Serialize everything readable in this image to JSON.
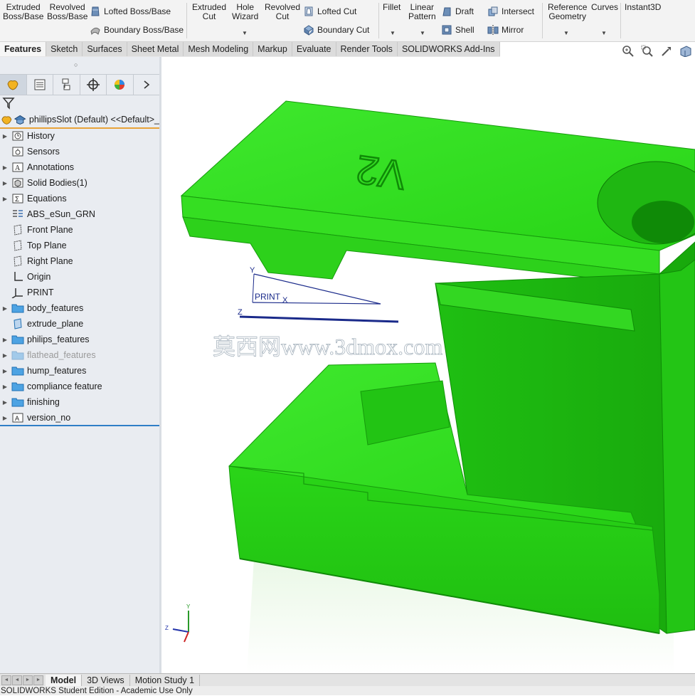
{
  "ribbon": {
    "extruded_boss": [
      "Extruded",
      "Boss/Base"
    ],
    "revolved_boss": [
      "Revolved",
      "Boss/Base"
    ],
    "lofted_boss": "Lofted Boss/Base",
    "boundary_boss": "Boundary Boss/Base",
    "extruded_cut": [
      "Extruded",
      "Cut"
    ],
    "hole_wizard": [
      "Hole",
      "Wizard"
    ],
    "revolved_cut": [
      "Revolved",
      "Cut"
    ],
    "lofted_cut": "Lofted Cut",
    "boundary_cut": "Boundary Cut",
    "fillet": "Fillet",
    "linear_pattern": [
      "Linear",
      "Pattern"
    ],
    "draft": "Draft",
    "shell": "Shell",
    "intersect": "Intersect",
    "mirror": "Mirror",
    "reference_geometry": [
      "Reference",
      "Geometry"
    ],
    "curves": "Curves",
    "instant3d": "Instant3D"
  },
  "command_tabs": [
    "Features",
    "Sketch",
    "Surfaces",
    "Sheet Metal",
    "Mesh Modeling",
    "Markup",
    "Evaluate",
    "Render Tools",
    "SOLIDWORKS Add-Ins"
  ],
  "active_tab": "Features",
  "tree": {
    "root": "phillipsSlot (Default) <<Default>_",
    "items": [
      {
        "label": "History",
        "icon": "history-icon",
        "expandable": true
      },
      {
        "label": "Sensors",
        "icon": "sensors-icon",
        "expandable": false
      },
      {
        "label": "Annotations",
        "icon": "annotations-icon",
        "expandable": true
      },
      {
        "label": "Solid Bodies(1)",
        "icon": "solid-bodies-icon",
        "expandable": true
      },
      {
        "label": "Equations",
        "icon": "equations-icon",
        "expandable": true
      },
      {
        "label": "ABS_eSun_GRN",
        "icon": "material-icon",
        "expandable": false
      },
      {
        "label": "Front Plane",
        "icon": "plane-icon",
        "expandable": false
      },
      {
        "label": "Top Plane",
        "icon": "plane-icon",
        "expandable": false
      },
      {
        "label": "Right Plane",
        "icon": "plane-icon",
        "expandable": false
      },
      {
        "label": "Origin",
        "icon": "origin-icon",
        "expandable": false
      },
      {
        "label": "PRINT",
        "icon": "coordinate-system-icon",
        "expandable": false
      },
      {
        "label": "body_features",
        "icon": "folder-icon",
        "expandable": true
      },
      {
        "label": "extrude_plane",
        "icon": "plane-feature-icon",
        "expandable": false
      },
      {
        "label": "philips_features",
        "icon": "folder-icon",
        "expandable": true
      },
      {
        "label": "flathead_features",
        "icon": "folder-icon",
        "expandable": true,
        "suppressed": true
      },
      {
        "label": "hump_features",
        "icon": "folder-icon",
        "expandable": true
      },
      {
        "label": "compliance feature",
        "icon": "folder-icon",
        "expandable": true
      },
      {
        "label": "finishing",
        "icon": "folder-icon",
        "expandable": true
      },
      {
        "label": "version_no",
        "icon": "version-text-icon",
        "expandable": true
      }
    ]
  },
  "viewport": {
    "part_text": "V2",
    "coord_label": "PRINT",
    "axis_labels": {
      "x": "X",
      "y": "Y",
      "z": "Z"
    },
    "watermark": "莫西网www.3dmox.com",
    "part_color": "#2bd419"
  },
  "bottom_tabs": [
    "Model",
    "3D Views",
    "Motion Study 1"
  ],
  "active_bottom_tab": "Model",
  "status": "SOLIDWORKS Student Edition - Academic Use Only"
}
